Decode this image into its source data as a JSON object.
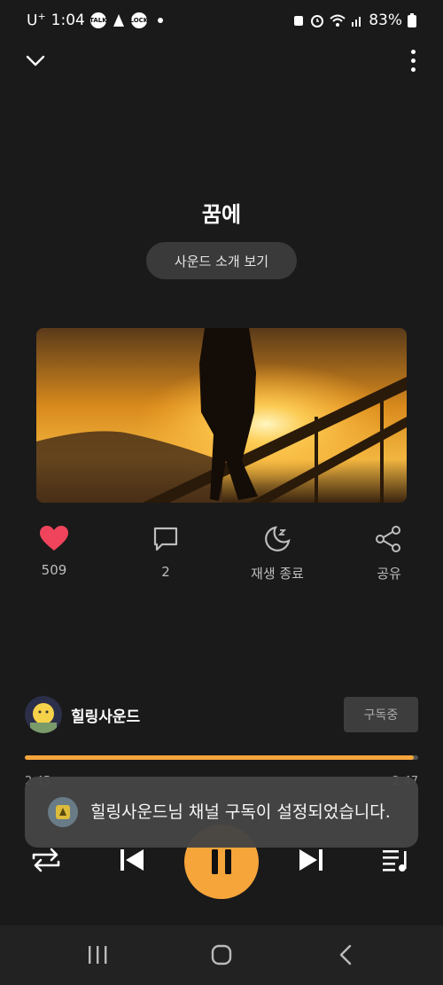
{
  "status": {
    "carrier": "U",
    "carrier_sup": "+",
    "time": "1:04",
    "talk_label": "TALK",
    "lock_label": "LOCK",
    "battery": "83%"
  },
  "track": {
    "title": "꿈에",
    "intro_label": "사운드 소개 보기"
  },
  "actions": {
    "likes": "509",
    "comments": "2",
    "sleep_label": "재생 종료",
    "share_label": "공유"
  },
  "channel": {
    "name": "힐링사운드",
    "subscribe_label": "구독중"
  },
  "player": {
    "elapsed": "2:45",
    "duration": "2:47",
    "progress_percent": 98.8
  },
  "toast": {
    "message": "힐링사운드님 채널 구독이 설정되었습니다."
  },
  "colors": {
    "accent": "#f6a53b",
    "like": "#f0445c",
    "background": "#1a1a1a"
  },
  "icons": {
    "collapse": "chevron-down-icon",
    "menu": "more-vertical-icon",
    "like": "heart-icon",
    "comment": "comment-icon",
    "sleep": "moon-icon",
    "share": "share-icon",
    "repeat": "repeat-icon",
    "previous": "skip-previous-icon",
    "pause": "pause-icon",
    "next": "skip-next-icon",
    "playlist": "playlist-icon"
  }
}
